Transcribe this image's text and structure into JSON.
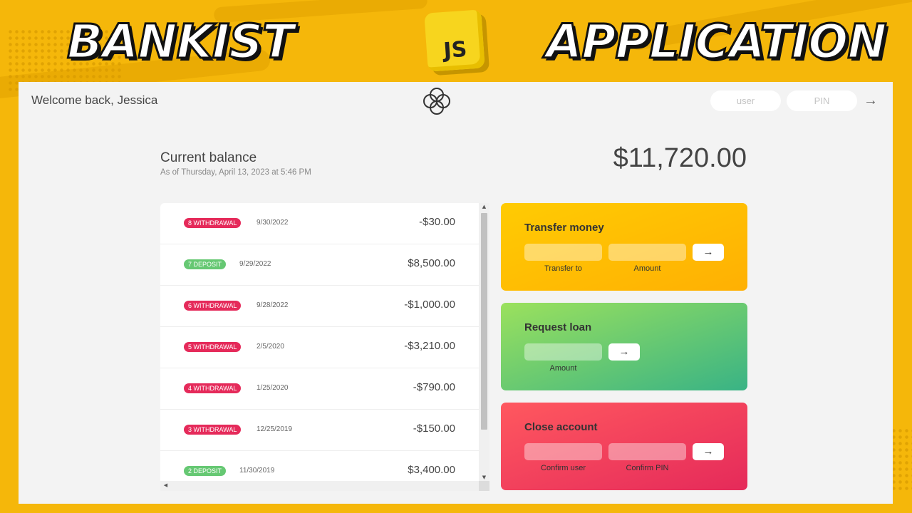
{
  "banner": {
    "left_text": "BANKIST",
    "badge_text": "JS",
    "right_text": "APPLICATION"
  },
  "nav": {
    "welcome": "Welcome back, Jessica",
    "user_placeholder": "user",
    "pin_placeholder": "PIN",
    "login_icon": "→"
  },
  "balance": {
    "label": "Current balance",
    "date": "As of Thursday, April 13, 2023 at 5:46 PM",
    "value": "$11,720.00"
  },
  "movements": [
    {
      "type": "8 WITHDRAWAL",
      "kind": "withdrawal",
      "date": "9/30/2022",
      "value": "-$30.00"
    },
    {
      "type": "7 DEPOSIT",
      "kind": "deposit",
      "date": "9/29/2022",
      "value": "$8,500.00"
    },
    {
      "type": "6 WITHDRAWAL",
      "kind": "withdrawal",
      "date": "9/28/2022",
      "value": "-$1,000.00"
    },
    {
      "type": "5 WITHDRAWAL",
      "kind": "withdrawal",
      "date": "2/5/2020",
      "value": "-$3,210.00"
    },
    {
      "type": "4 WITHDRAWAL",
      "kind": "withdrawal",
      "date": "1/25/2020",
      "value": "-$790.00"
    },
    {
      "type": "3 WITHDRAWAL",
      "kind": "withdrawal",
      "date": "12/25/2019",
      "value": "-$150.00"
    },
    {
      "type": "2 DEPOSIT",
      "kind": "deposit",
      "date": "11/30/2019",
      "value": "$3,400.00"
    }
  ],
  "operations": {
    "transfer": {
      "title": "Transfer money",
      "label_to": "Transfer to",
      "label_amount": "Amount",
      "button": "→"
    },
    "loan": {
      "title": "Request loan",
      "label_amount": "Amount",
      "button": "→"
    },
    "close": {
      "title": "Close account",
      "label_user": "Confirm user",
      "label_pin": "Confirm PIN",
      "button": "→"
    }
  },
  "colors": {
    "withdrawal": "#e52a5a",
    "deposit": "#66c873",
    "background": "#f5b70a"
  }
}
